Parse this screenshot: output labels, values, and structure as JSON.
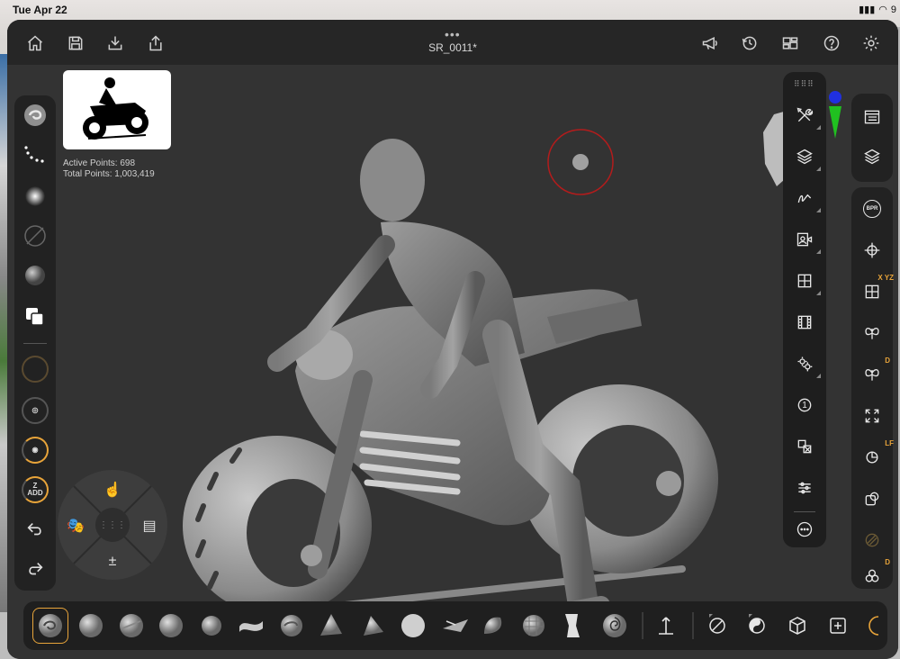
{
  "status_bar": {
    "time": "Tue Apr 22",
    "battery": "9"
  },
  "app": {
    "document_title": "SR_0011*",
    "grabber": "•••"
  },
  "stats": {
    "active_points": "Active Points: 698",
    "total_points": "Total Points: 1,003,419"
  },
  "left_tools": {
    "zadd_label": "Z\nADD"
  },
  "right_tools": {
    "bpr_label": "BPR",
    "xyz_badge": "X YZ",
    "d_badge": "D",
    "lf_badge": "LF",
    "d2_badge": "D",
    "one_label": "1"
  },
  "colors": {
    "accent": "#e8a43a",
    "app_bg": "#2c2c2c",
    "viewport_bg": "#333333",
    "panel_bg": "#1e1e1e",
    "gizmo_red": "#d42020",
    "gizmo_green": "#20c020",
    "gizmo_blue": "#2030e0"
  }
}
